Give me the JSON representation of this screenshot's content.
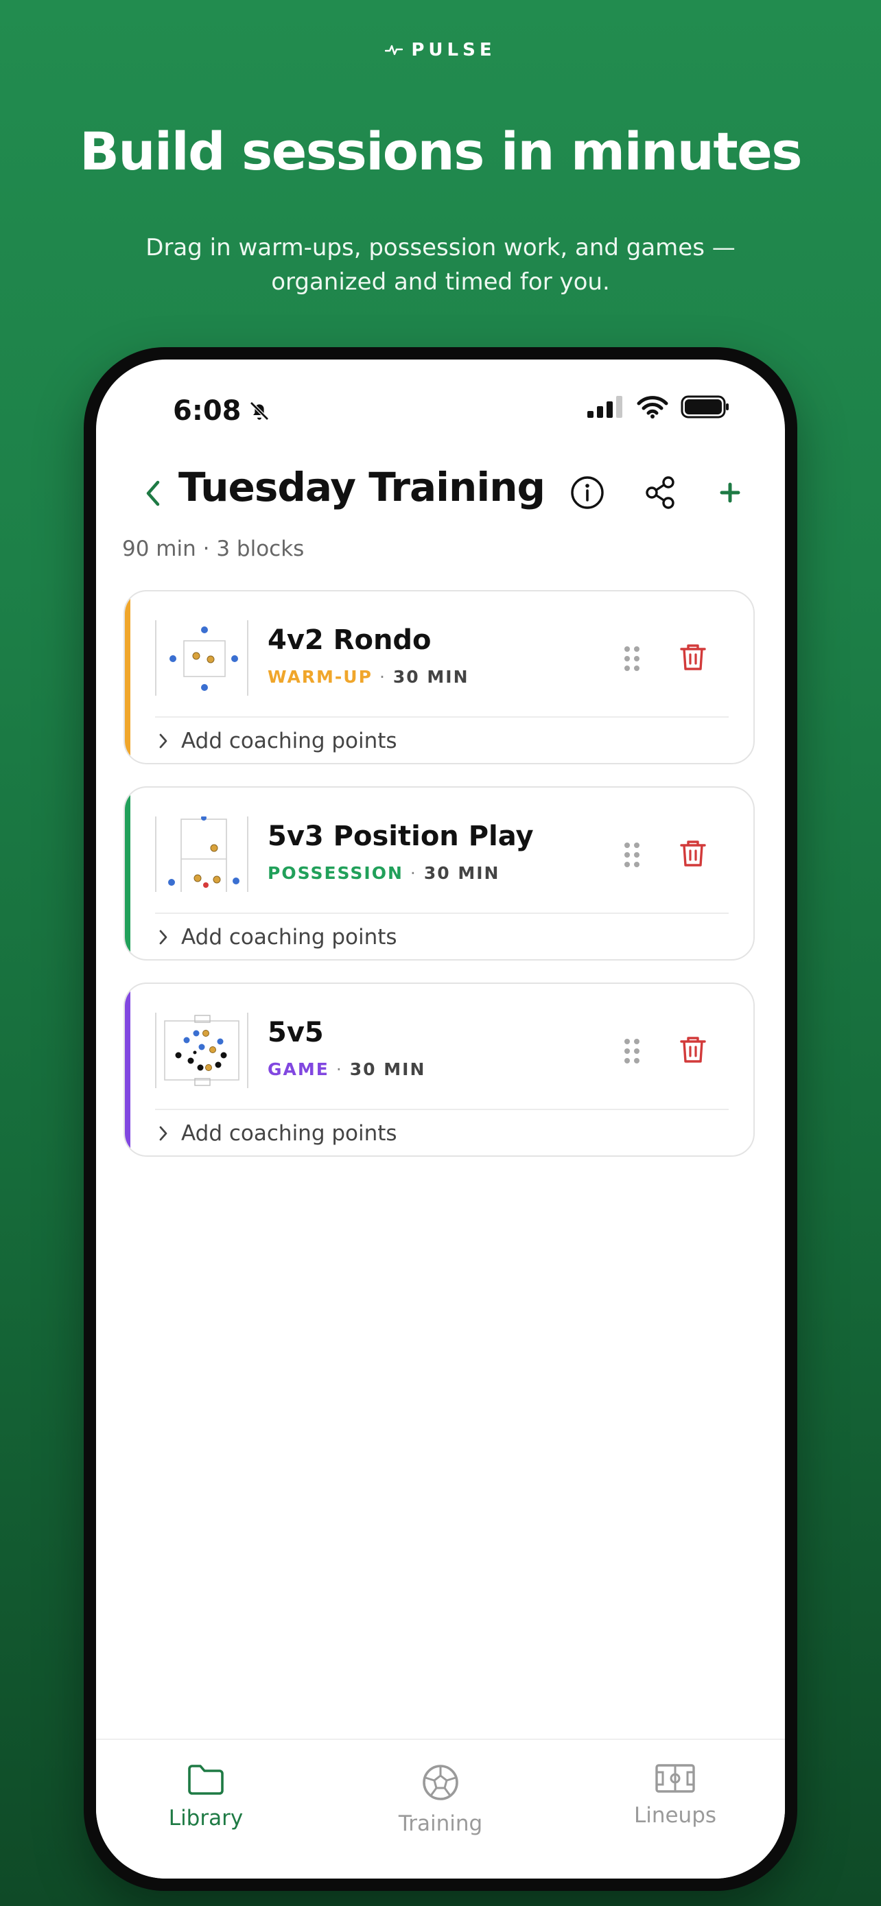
{
  "brand": {
    "name": "PULSE",
    "icon": "pulse-icon"
  },
  "marketing": {
    "headline": "Build sessions in minutes",
    "subhead": "Drag in warm-ups, possession work, and games — organized and timed for you."
  },
  "status_bar": {
    "time": "6:08",
    "icons": [
      "bell-slash-icon",
      "signal-icon",
      "wifi-icon",
      "battery-icon"
    ]
  },
  "nav": {
    "title": "Tuesday Training",
    "back_icon": "chevron-left-icon",
    "actions": [
      "info-icon",
      "share-icon",
      "plus-icon"
    ]
  },
  "session": {
    "meta": "90 min · 3 blocks"
  },
  "drills": [
    {
      "title": "4v2 Rondo",
      "category": "WARM-UP",
      "duration": "30 MIN",
      "color": "#f0a62b",
      "coaching": "Add coaching points"
    },
    {
      "title": "5v3 Position Play",
      "category": "POSSESSION",
      "duration": "30 MIN",
      "color": "#21a05a",
      "coaching": "Add coaching points"
    },
    {
      "title": "5v5",
      "category": "GAME",
      "duration": "30 MIN",
      "color": "#8147e0",
      "coaching": "Add coaching points"
    }
  ],
  "tabs": [
    {
      "label": "Library",
      "icon": "folder-icon",
      "active": true
    },
    {
      "label": "Training",
      "icon": "soccer-ball-icon",
      "active": false
    },
    {
      "label": "Lineups",
      "icon": "pitch-icon",
      "active": false
    }
  ],
  "colors": {
    "accent": "#1e7a44",
    "danger": "#d23a3a",
    "background": "#228c4f"
  }
}
